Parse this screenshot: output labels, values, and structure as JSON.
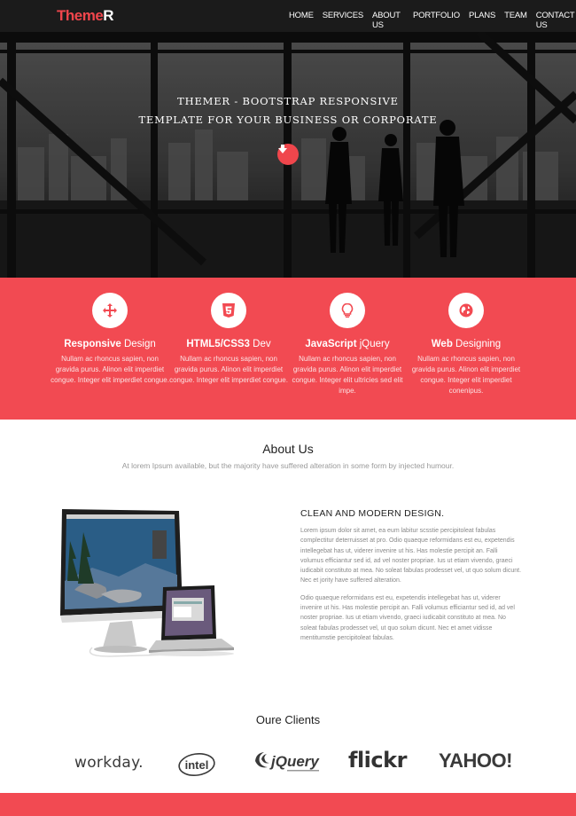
{
  "nav": {
    "logo_part1": "Theme",
    "logo_part2": "R",
    "items": [
      {
        "label": "HOME"
      },
      {
        "label": "SERVICES"
      },
      {
        "label": "ABOUT US"
      },
      {
        "label": "PORTFOLIO"
      },
      {
        "label": "PLANS"
      },
      {
        "label": "TEAM"
      },
      {
        "label": "CONTACT US"
      }
    ]
  },
  "hero": {
    "line1": "THEMER - BOOTSTRAP RESPONSIVE",
    "line2": "TEMPLATE FOR YOUR BUSINESS OR CORPORATE",
    "button_icon": "arrow-down-icon"
  },
  "services": [
    {
      "icon": "move-icon",
      "title_bold": "Responsive",
      "title_rest": " Design",
      "desc": "Nullam ac rhoncus sapien, non gravida purus. Alinon elit imperdiet congue. Integer elit imperdiet congue."
    },
    {
      "icon": "html5-icon",
      "title_bold": "HTML5/CSS3",
      "title_rest": " Dev",
      "desc": "Nullam ac rhoncus sapien, non gravida purus. Alinon elit imperdiet congue. Integer elit imperdiet congue."
    },
    {
      "icon": "lightbulb-icon",
      "title_bold": "JavaScript",
      "title_rest": " jQuery",
      "desc": "Nullam ac rhoncus sapien, non gravida purus. Alinon elit imperdiet congue. Integer elit ultricies sed elit impe."
    },
    {
      "icon": "globe-icon",
      "title_bold": "Web",
      "title_rest": " Designing",
      "desc": "Nullam ac rhoncus sapien, non gravida purus. Alinon elit imperdiet congue. Integer elit imperdiet conenipus."
    }
  ],
  "about": {
    "heading": "About Us",
    "subheading": "At lorem Ipsum available, but the majority have suffered alteration in some form by injected humour.",
    "title": "CLEAN AND MODERN DESIGN.",
    "para1": "Lorem ipsum dolor sit amet, ea eum labitur scsstie percipitoleat fabulas complectitur deterruisset at pro. Odio quaeque reformidans est eu, expetendis intellegebat has ut, viderer invenire ut his. Has molestie percipit an. Falli volumus efficiantur sed id, ad vel noster propriae. Ius ut etiam vivendo, graeci iudicabit constituto at mea. No soleat fabulas prodesset vel, ut quo solum dicunt. Nec et jority have suffered alteration.",
    "para2": "Odio quaeque reformidans est eu, expetendis intellegebat has ut, viderer invenire ut his. Has molestie percipit an. Falli volumus efficiantur sed id, ad vel noster propriae. Ius ut etiam vivendo, graeci iudicabit constituto at mea. No soleat fabulas prodesset vel, ut quo solum dicunt. Nec et amet vidisse mentitumstie percipitoleat fabulas."
  },
  "clients": {
    "heading": "Oure Clients",
    "logos": [
      "workday.",
      "intel",
      "jQuery",
      "flickr",
      "YAHOO!"
    ]
  },
  "colors": {
    "accent": "#f24a52",
    "nav_bg": "#1b1b1b"
  }
}
